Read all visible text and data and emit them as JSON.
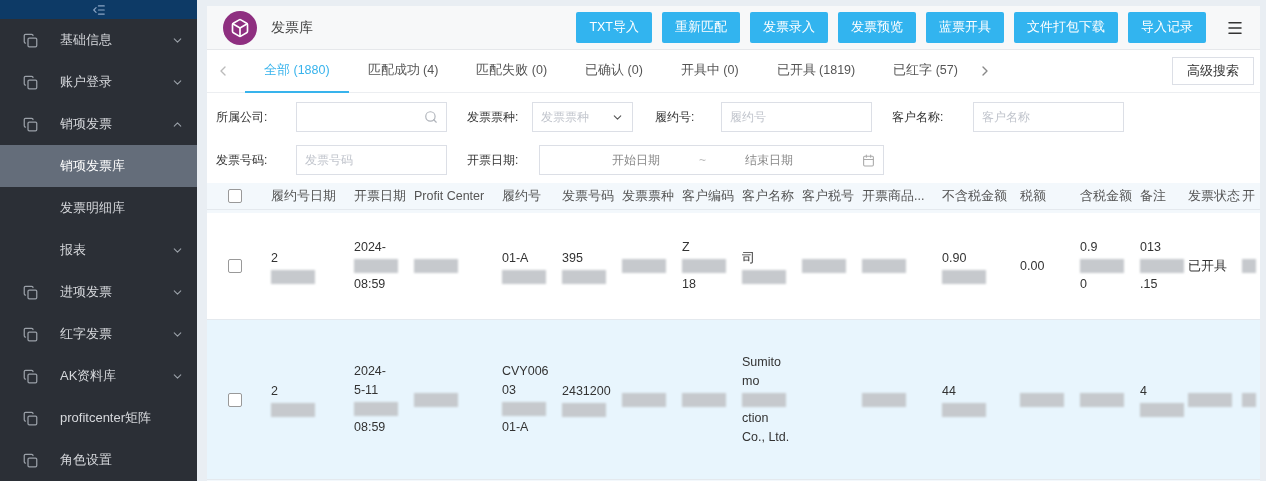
{
  "sidebar": {
    "items": [
      {
        "label": "基础信息",
        "expanded": false,
        "selected": false
      },
      {
        "label": "账户登录",
        "expanded": false,
        "selected": false
      },
      {
        "label": "销项发票",
        "expanded": true,
        "selected": false,
        "children": [
          {
            "label": "销项发票库",
            "selected": true,
            "has_children": false
          },
          {
            "label": "发票明细库",
            "selected": false,
            "has_children": false
          },
          {
            "label": "报表",
            "selected": false,
            "has_children": true
          }
        ]
      },
      {
        "label": "进项发票",
        "expanded": false,
        "selected": false
      },
      {
        "label": "红字发票",
        "expanded": false,
        "selected": false
      },
      {
        "label": "AK资料库",
        "expanded": false,
        "selected": false
      },
      {
        "label": "profitcenter矩阵",
        "selected": false
      },
      {
        "label": "角色设置",
        "selected": false
      }
    ]
  },
  "page": {
    "title": "发票库"
  },
  "toolbar": {
    "buttons": [
      "TXT导入",
      "重新匹配",
      "发票录入",
      "发票预览",
      "蓝票开具",
      "文件打包下载",
      "导入记录"
    ]
  },
  "tabs": [
    {
      "label": "全部 (1880)",
      "selected": true
    },
    {
      "label": "匹配成功 (4)",
      "selected": false
    },
    {
      "label": "匹配失败 (0)",
      "selected": false
    },
    {
      "label": "已确认 (0)",
      "selected": false
    },
    {
      "label": "开具中 (0)",
      "selected": false
    },
    {
      "label": "已开具 (1819)",
      "selected": false
    },
    {
      "label": "已红字 (57)",
      "selected": false
    }
  ],
  "advanced_search": "高级搜索",
  "filters": [
    {
      "label": "所属公司:",
      "kind": "search"
    },
    {
      "label": "发票票种:",
      "kind": "select",
      "placeholder": "发票票种"
    },
    {
      "label": "履约号:",
      "kind": "text",
      "placeholder": "履约号"
    },
    {
      "label": "客户名称:",
      "kind": "text",
      "placeholder": "客户名称"
    },
    {
      "label": "发票号码:",
      "kind": "text",
      "placeholder": "发票号码"
    },
    {
      "label": "开票日期:",
      "kind": "daterange",
      "placeholder": "开始日期",
      "placeholder_end": "结束日期",
      "separator": "~"
    }
  ],
  "table": {
    "select_all_checked": false,
    "columns": [
      "履约号日期",
      "开票日期",
      "Profit Center",
      "履约号",
      "发票号码",
      "发票票种",
      "客户编码",
      "客户名称",
      "客户税号",
      "开票商品...",
      "不含税金额",
      "税额",
      "含税金额",
      "备注",
      "发票状态",
      "开"
    ],
    "rows": [
      {
        "checked": false,
        "highlighted": false,
        "cells": [
          {
            "lines": [
              "2"
            ],
            "redacted": true
          },
          {
            "lines": [
              "2024-",
              "08:59"
            ],
            "redacted": true
          },
          {
            "redacted": true
          },
          {
            "lines": [
              "01-A"
            ],
            "redacted": true
          },
          {
            "lines": [
              "395"
            ],
            "redacted": true
          },
          {
            "redacted": true
          },
          {
            "lines": [
              "Z",
              "18"
            ],
            "redacted": true
          },
          {
            "lines": [
              "司"
            ],
            "redacted": true
          },
          {
            "redacted": true
          },
          {
            "redacted": true
          },
          {
            "lines": [
              "0.90"
            ],
            "redacted": true
          },
          {
            "lines": [
              "0.00"
            ],
            "redacted": false
          },
          {
            "lines": [
              "0.9",
              "0"
            ],
            "redacted": true
          },
          {
            "lines": [
              "013",
              ".15"
            ],
            "redacted": true
          },
          {
            "lines": [
              "已开具"
            ],
            "redacted": false
          },
          {
            "redacted": true
          }
        ]
      },
      {
        "checked": false,
        "highlighted": true,
        "cells": [
          {
            "lines": [
              "2"
            ],
            "redacted": true
          },
          {
            "lines": [
              "2024-",
              "5-11",
              "08:59"
            ],
            "redacted": true
          },
          {
            "redacted": true
          },
          {
            "lines": [
              "CVY006",
              "03",
              "01-A"
            ],
            "redacted": true
          },
          {
            "lines": [
              "2431200"
            ],
            "redacted": true
          },
          {
            "redacted": true
          },
          {
            "redacted": true
          },
          {
            "lines": [
              "Sumito",
              "mo",
              "ction",
              "Co., Ltd."
            ],
            "redacted": true
          },
          null,
          {
            "redacted": true
          },
          {
            "lines": [
              "44"
            ],
            "redacted": true
          },
          {
            "redacted": true
          },
          {
            "redacted": true
          },
          {
            "lines": [
              "4"
            ],
            "redacted": true
          },
          {
            "redacted": true
          },
          {
            "redacted": true
          }
        ]
      }
    ]
  }
}
